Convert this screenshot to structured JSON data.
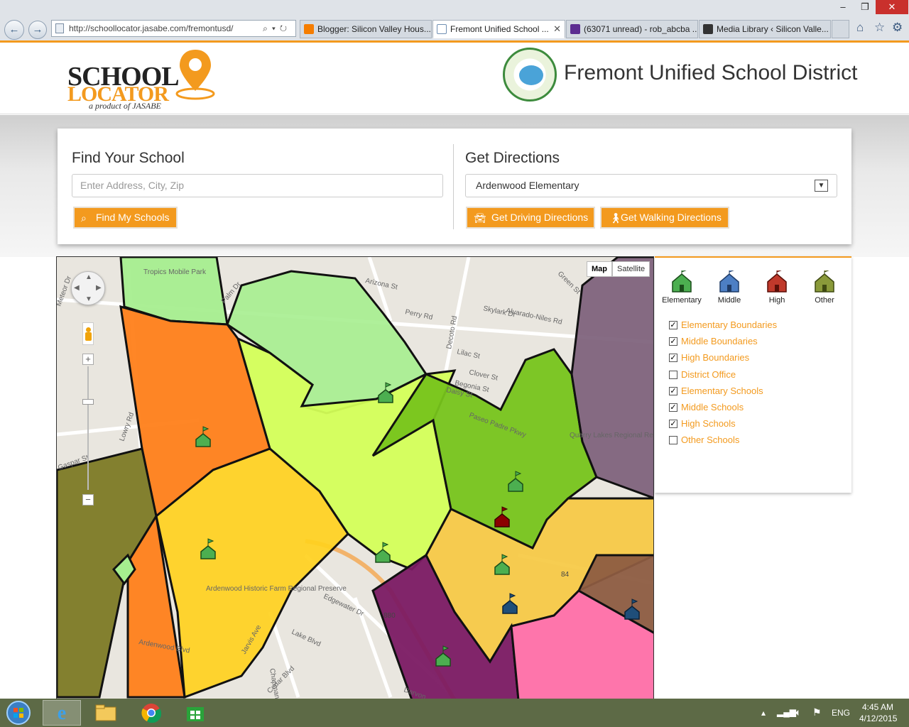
{
  "browser": {
    "url": "http://schoollocator.jasabe.com/fremontusd/",
    "tabs": [
      {
        "label": "Blogger: Silicon Valley Hous...",
        "color": "#f57d00"
      },
      {
        "label": "Fremont Unified School ...",
        "color": "#6f8fb3",
        "active": true
      },
      {
        "label": "(63071 unread) - rob_abcba ...",
        "color": "#5c2d91"
      },
      {
        "label": "Media Library ‹ Silicon Valle...",
        "color": "#333333"
      }
    ]
  },
  "header": {
    "logo_line1": "SCHOOL",
    "logo_line2": "LOCATOR",
    "logo_tagline": "a product of JASABE",
    "district_name": "Fremont Unified School District"
  },
  "find": {
    "title": "Find Your School",
    "placeholder": "Enter Address, City, Zip",
    "button": "Find My Schools"
  },
  "directions": {
    "title": "Get Directions",
    "selected_school": "Ardenwood Elementary",
    "driving_button": "Get Driving Directions",
    "walking_button": "Get Walking Directions"
  },
  "map": {
    "type_map": "Map",
    "type_satellite": "Satellite",
    "labels": [
      {
        "text": "Tropics Mobile Park"
      },
      {
        "text": "Arizona St"
      },
      {
        "text": "Palm Dr"
      },
      {
        "text": "Green St"
      },
      {
        "text": "Perry Rd"
      },
      {
        "text": "Skylark Dr"
      },
      {
        "text": "Alvarado-Niles Rd"
      },
      {
        "text": "Decoto Rd"
      },
      {
        "text": "Lilac St"
      },
      {
        "text": "Clover St"
      },
      {
        "text": "Begonia St"
      },
      {
        "text": "Daisy St"
      },
      {
        "text": "Quarry Lakes Regional Recreation Area"
      },
      {
        "text": "Paseo Padre Pkwy"
      },
      {
        "text": "Meteor Dr"
      },
      {
        "text": "Lowry Rd"
      },
      {
        "text": "Gaspar St"
      },
      {
        "text": "Ardenwood Historic Farm Regional Preserve"
      },
      {
        "text": "Edgewater Dr"
      },
      {
        "text": "Lake Blvd"
      },
      {
        "text": "Jarvis Ave"
      },
      {
        "text": "Chapman Dr"
      },
      {
        "text": "Cedar Blvd"
      },
      {
        "text": "Ardenwood Blvd"
      },
      {
        "text": "Darvon"
      },
      {
        "text": "880"
      },
      {
        "text": "84"
      }
    ]
  },
  "legend": {
    "school_types": [
      {
        "label": "Elementary",
        "color": "#4caf50"
      },
      {
        "label": "Middle",
        "color": "#4d7fc4"
      },
      {
        "label": "High",
        "color": "#c0392b"
      },
      {
        "label": "Other",
        "color": "#8a9a3a"
      }
    ],
    "layers": [
      {
        "label": "Elementary Boundaries",
        "checked": true
      },
      {
        "label": "Middle Boundaries",
        "checked": true
      },
      {
        "label": "High Boundaries",
        "checked": true
      },
      {
        "label": "District Office",
        "checked": false
      },
      {
        "label": "Elementary Schools",
        "checked": true
      },
      {
        "label": "Middle Schools",
        "checked": true
      },
      {
        "label": "High Schools",
        "checked": true
      },
      {
        "label": "Other Schools",
        "checked": false
      }
    ]
  },
  "taskbar": {
    "language": "ENG",
    "time": "4:45 AM",
    "date": "4/12/2015"
  }
}
